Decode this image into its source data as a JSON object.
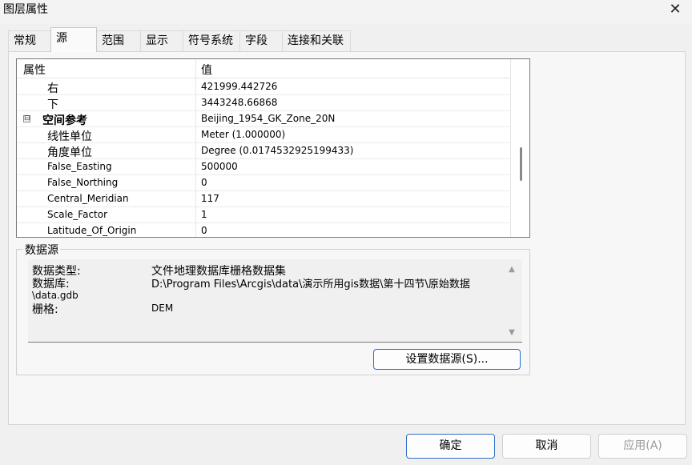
{
  "window": {
    "title": "图层属性"
  },
  "tabs": [
    "常规",
    "源",
    "范围",
    "显示",
    "符号系统",
    "字段",
    "连接和关联"
  ],
  "grid": {
    "header": {
      "col1": "属性",
      "col2": "值"
    },
    "rows": [
      {
        "name": "右",
        "value": "421999.442726"
      },
      {
        "name": "下",
        "value": "3443248.66868"
      },
      {
        "name": "空间参考",
        "value": "Beijing_1954_GK_Zone_20N",
        "expander": "⊟"
      },
      {
        "name": "线性单位",
        "value": "Meter (1.000000)"
      },
      {
        "name": "角度单位",
        "value": "Degree (0.0174532925199433)"
      },
      {
        "name": "False_Easting",
        "value": "500000"
      },
      {
        "name": "False_Northing",
        "value": "0"
      },
      {
        "name": "Central_Meridian",
        "value": "117"
      },
      {
        "name": "Scale_Factor",
        "value": "1"
      },
      {
        "name": "Latitude_Of_Origin",
        "value": "0"
      }
    ]
  },
  "datasource": {
    "legend": "数据源",
    "type_label": "数据类型:",
    "type_value": "文件地理数据库栅格数据集",
    "db_label": "数据库:",
    "db_value": "D:\\Program Files\\Arcgis\\data\\演示所用gis数据\\第十四节\\原始数据",
    "db_value_cont": "\\data.gdb",
    "raster_label": "栅格:",
    "raster_value": "DEM",
    "set_button": "设置数据源(S)..."
  },
  "footer": {
    "ok": "确定",
    "cancel": "取消",
    "apply": "应用(A)"
  }
}
